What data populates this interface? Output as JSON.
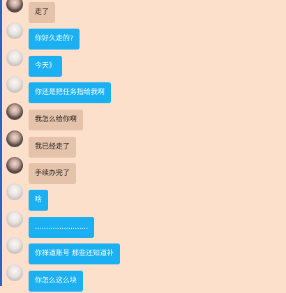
{
  "colors": {
    "background": "#fde0cc",
    "bubble_received": "#e5c3ab",
    "bubble_sent": "#1ab0f2",
    "accent_strip": "#2a63c6"
  },
  "messages": [
    {
      "text": "走了",
      "bubble": "tan",
      "avatar": "dark"
    },
    {
      "text": "你好久走的?",
      "bubble": "blue",
      "avatar": "light"
    },
    {
      "text": "今天》",
      "bubble": "blue",
      "avatar": "light"
    },
    {
      "text": "你还是把任务指给我啊",
      "bubble": "blue",
      "avatar": "light"
    },
    {
      "text": "我怎么给你啊",
      "bubble": "tan",
      "avatar": "dark"
    },
    {
      "text": "我已经走了",
      "bubble": "tan",
      "avatar": "dark"
    },
    {
      "text": "手续办完了",
      "bubble": "tan",
      "avatar": "dark"
    },
    {
      "text": "啥",
      "bubble": "blue",
      "avatar": "light"
    },
    {
      "text": "........................",
      "bubble": "blue",
      "avatar": "light"
    },
    {
      "text": "你禅道账号  那些还知道补",
      "bubble": "blue",
      "avatar": "light"
    },
    {
      "text": "你怎么这么块",
      "bubble": "blue",
      "avatar": "light"
    }
  ]
}
